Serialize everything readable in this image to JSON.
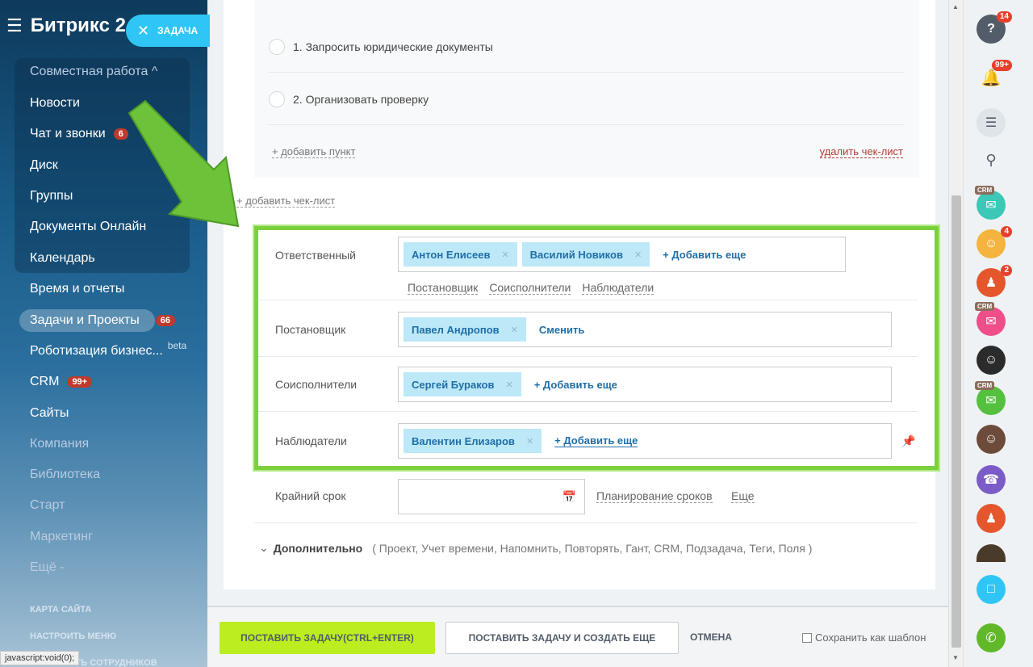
{
  "sidebar": {
    "brand": "Битрикс 2",
    "group_title": "Совместная работа ^",
    "items": [
      {
        "label": "Новости"
      },
      {
        "label": "Чат и звонки",
        "badge": "6"
      },
      {
        "label": "Диск"
      },
      {
        "label": "Группы"
      },
      {
        "label": "Документы Онлайн"
      },
      {
        "label": "Календарь"
      },
      {
        "label": "Время и отчеты"
      },
      {
        "label": "Задачи и Проекты",
        "badge": "66"
      },
      {
        "label": "Роботизация бизнес...",
        "suffix": "beta"
      },
      {
        "label": "CRM",
        "badge": "99+"
      },
      {
        "label": "Сайты"
      },
      {
        "label": "Компания"
      },
      {
        "label": "Библиотека"
      },
      {
        "label": "Старт"
      },
      {
        "label": "Маркетинг"
      },
      {
        "label": "Ещё -"
      }
    ],
    "site_map": "КАРТА САЙТА",
    "configure_menu": "НАСТРОИТЬ МЕНЮ",
    "invite_cut": "СТЬ СОТРУДНИКОВ",
    "status_text": "javascript:void(0);"
  },
  "task_pill": {
    "label": "ЗАДАЧА"
  },
  "checklist": {
    "items": [
      "1. Запросить юридические документы",
      "2. Организовать проверку"
    ],
    "add_item": "+ добавить пункт",
    "delete": "удалить чек-лист",
    "add_checklist": "+ добавить чек-лист"
  },
  "form": {
    "responsible": {
      "label": "Ответственный",
      "chips": [
        "Антон Елисеев",
        "Василий Новиков"
      ],
      "add": "+ Добавить еще",
      "sub_links": [
        "Постановщик",
        "Соисполнители",
        "Наблюдатели"
      ]
    },
    "creator": {
      "label": "Постановщик",
      "chips": [
        "Павел Андропов"
      ],
      "action": "Сменить"
    },
    "coexecutors": {
      "label": "Соисполнители",
      "chips": [
        "Сергей Бураков"
      ],
      "add": "+ Добавить еще"
    },
    "observers": {
      "label": "Наблюдатели",
      "chips": [
        "Валентин Елизаров"
      ],
      "add": "+ Добавить еще"
    },
    "deadline": {
      "label": "Крайний срок",
      "value": "",
      "links": [
        "Планирование сроков",
        "Еще"
      ]
    },
    "more": {
      "title": "Дополнительно",
      "items": "( Проект,  Учет времени,  Напомнить,  Повторять,  Гант,  CRM,  Подзадача,  Теги,  Поля )"
    }
  },
  "footer": {
    "primary": "ПОСТАВИТЬ ЗАДАЧУ(CTRL+ENTER)",
    "secondary": "ПОСТАВИТЬ ЗАДАЧУ И СОЗДАТЬ ЕЩЕ",
    "cancel": "ОТМЕНА",
    "save_template": "Сохранить как шаблон"
  },
  "rail": {
    "help_badge": "14",
    "notify_badge": "99+",
    "avatar_badge_1": "4",
    "group_badge": "2",
    "crm_tag": "CRM"
  },
  "colors": {
    "accent_green": "#7bd03d",
    "primary_button": "#bbed21",
    "chip_bg": "#bce8f8",
    "link_blue": "#1f6ea7",
    "pill": "#2fc6f6"
  }
}
